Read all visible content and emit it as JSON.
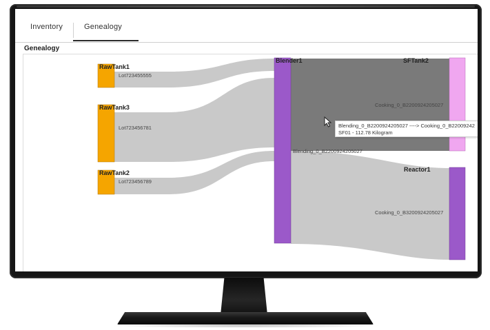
{
  "tabs": [
    {
      "label": "Inventory",
      "active": false
    },
    {
      "label": "Genealogy",
      "active": true
    }
  ],
  "section_title": "Genealogy",
  "sankey": {
    "nodes": [
      {
        "id": "rawtank1",
        "label": "RawTank1",
        "color": "#f5a500"
      },
      {
        "id": "rawtank3",
        "label": "RawTank3",
        "color": "#f5a500"
      },
      {
        "id": "rawtank2",
        "label": "RawTank2",
        "color": "#f5a500"
      },
      {
        "id": "blender1",
        "label": "Blender1",
        "color": "#9b59c9"
      },
      {
        "id": "sftank2",
        "label": "SFTank2",
        "color": "#f0a7f0"
      },
      {
        "id": "reactor1",
        "label": "Reactor1",
        "color": "#9b59c9"
      }
    ],
    "links": [
      {
        "source": "rawtank1",
        "target": "blender1",
        "label": "Lot723455555"
      },
      {
        "source": "rawtank3",
        "target": "blender1",
        "label": "Lot723456781"
      },
      {
        "source": "rawtank2",
        "target": "blender1",
        "label": "Lot723456789"
      },
      {
        "source": "blender1",
        "target": "sftank2",
        "label": "Cooking_0_B2200924205027",
        "highlighted": true
      },
      {
        "source": "blender1",
        "target": "reactor1",
        "label": "Cooking_0_B3200924205027"
      }
    ],
    "blender_output_label": "Blending_0_B2200924205027"
  },
  "tooltip": {
    "line1": "Blending_0_B2200924205027 ----> Cooking_0_B22009242",
    "line2": "SF01 - 112.78 Kilogram"
  },
  "colors": {
    "source_node": "#f5a500",
    "process_node": "#9b59c9",
    "sftank_node": "#f0a7f0",
    "link": "#c9c9c9",
    "link_highlight": "#7a7a7a"
  }
}
